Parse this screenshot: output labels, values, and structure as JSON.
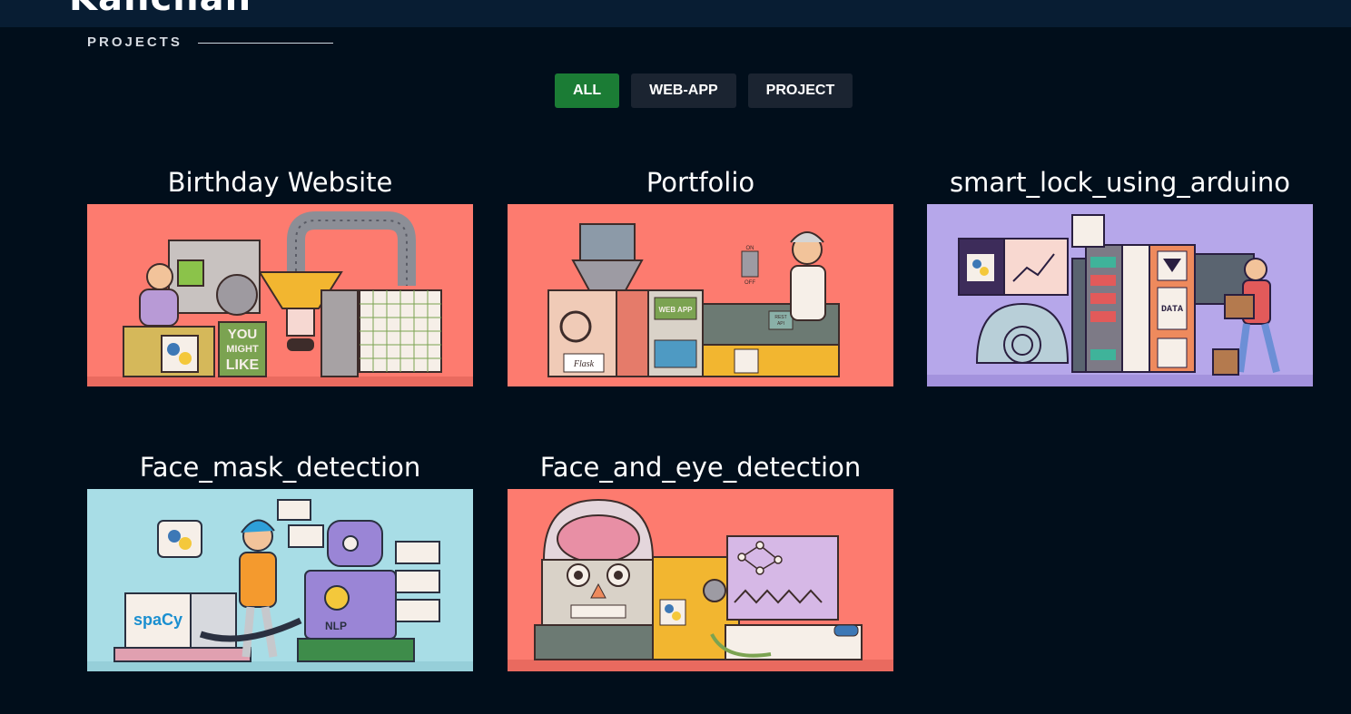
{
  "header": {
    "brand": "Kanchan"
  },
  "section": {
    "label": "PROJECTS"
  },
  "filters": [
    {
      "label": "ALL",
      "active": true
    },
    {
      "label": "WEB-APP",
      "active": false
    },
    {
      "label": "PROJECT",
      "active": false
    }
  ],
  "projects": [
    {
      "title": "Birthday Website",
      "thumb_bg": "#fd7b6f",
      "thumb_text": [
        "YOU",
        "MIGHT",
        "LIKE"
      ]
    },
    {
      "title": "Portfolio",
      "thumb_bg": "#fd7b6f",
      "thumb_text": [
        "Flask",
        "WEB APP",
        "REST API",
        "ON",
        "OFF"
      ]
    },
    {
      "title": "smart_lock_using_arduino",
      "thumb_bg": "#b6a7ea",
      "thumb_text": [
        "DATA"
      ]
    },
    {
      "title": "Face_mask_detection",
      "thumb_bg": "#a8dde6",
      "thumb_text": [
        "spaCy",
        "NLP"
      ]
    },
    {
      "title": "Face_and_eye_detection",
      "thumb_bg": "#fd7b6f",
      "thumb_text": []
    }
  ]
}
